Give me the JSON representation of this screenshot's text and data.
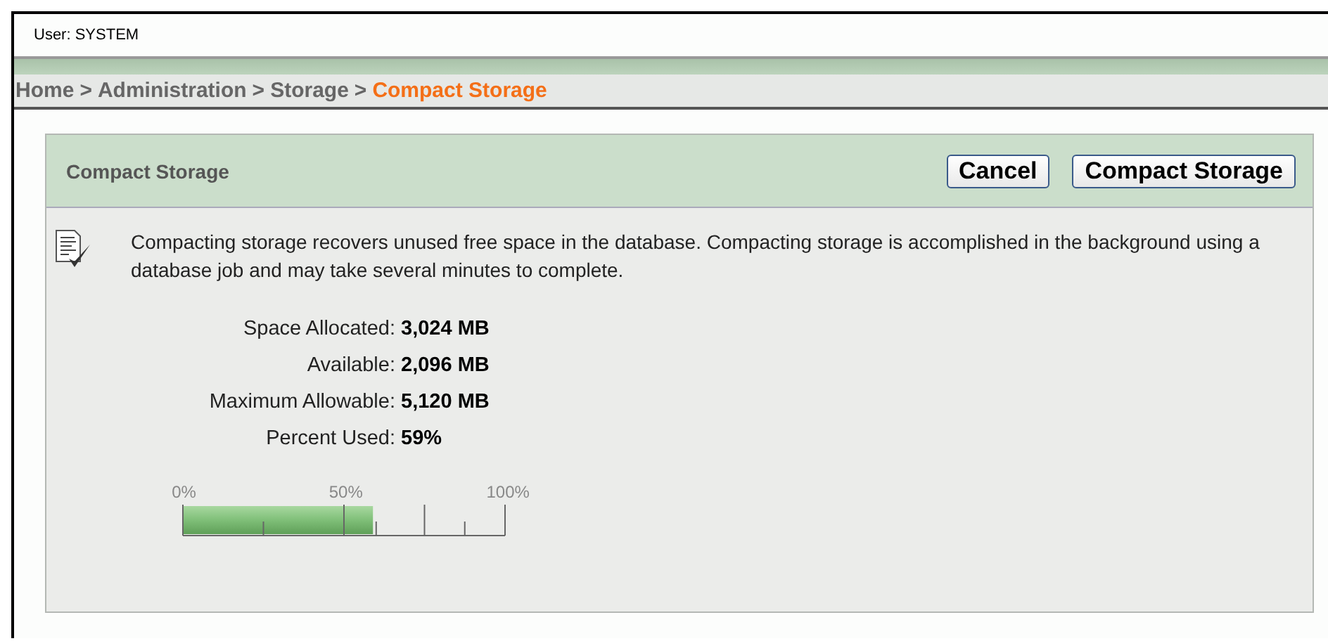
{
  "user_label": "User: SYSTEM",
  "breadcrumb": [
    {
      "kind": "link",
      "label": "Home",
      "selected": false
    },
    {
      "kind": "separator",
      "label": ">"
    },
    {
      "kind": "link",
      "label": "Administration",
      "selected": false
    },
    {
      "kind": "separator",
      "label": ">"
    },
    {
      "kind": "link",
      "label": "Storage",
      "selected": false
    },
    {
      "kind": "separator",
      "label": ">"
    },
    {
      "kind": "link",
      "label": "Compact Storage",
      "selected": true
    }
  ],
  "panel": {
    "title": "Compact Storage",
    "buttons": [
      "Cancel",
      "Compact Storage"
    ],
    "description": "Compacting storage recovers unused free space in the database. Compacting storage is accomplished in the background using a database job and may take several minutes to complete.",
    "stats": [
      {
        "label": "Space Allocated:",
        "value": "3,024 MB"
      },
      {
        "label": "Available:",
        "value": "2,096 MB"
      },
      {
        "label": "Maximum Allowable:",
        "value": "5,120 MB"
      },
      {
        "label": "Percent Used:",
        "value": "59%"
      }
    ],
    "gauge": {
      "level": 0.59,
      "tick_labels": [
        "0%",
        "50%",
        "100%"
      ]
    }
  }
}
